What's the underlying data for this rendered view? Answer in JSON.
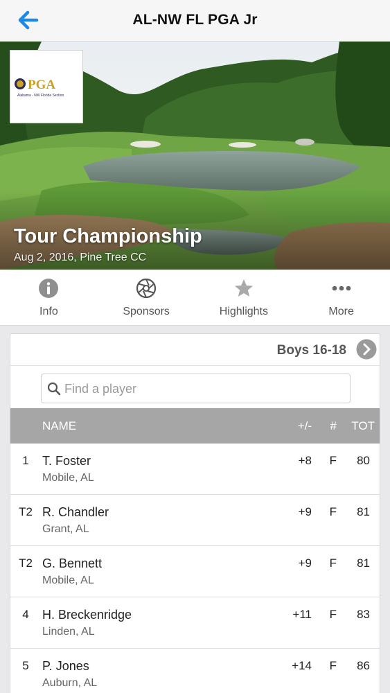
{
  "nav": {
    "title": "AL-NW FL PGA Jr",
    "back_icon": "back-arrow-icon"
  },
  "event": {
    "title": "Tour Championship",
    "subtitle": "Aug 2, 2016, Pine Tree CC",
    "logo": {
      "brand": "PGA",
      "tagline": "Alabama - NW Florida Section"
    }
  },
  "tabs": [
    {
      "label": "Info",
      "icon": "info-icon"
    },
    {
      "label": "Sponsors",
      "icon": "aperture-icon"
    },
    {
      "label": "Highlights",
      "icon": "star-icon"
    },
    {
      "label": "More",
      "icon": "ellipsis-icon"
    }
  ],
  "leaderboard": {
    "division": "Boys 16-18",
    "search_placeholder": "Find a player",
    "columns": {
      "name": "NAME",
      "plus_minus": "+/-",
      "thru": "#",
      "total": "TOT"
    },
    "rows": [
      {
        "pos": "1",
        "name": "T. Foster",
        "city": "Mobile, AL",
        "pm": "+8",
        "thru": "F",
        "tot": "80"
      },
      {
        "pos": "T2",
        "name": "R. Chandler",
        "city": "Grant, AL",
        "pm": "+9",
        "thru": "F",
        "tot": "81"
      },
      {
        "pos": "T2",
        "name": "G. Bennett",
        "city": "Mobile, AL",
        "pm": "+9",
        "thru": "F",
        "tot": "81"
      },
      {
        "pos": "4",
        "name": "H. Breckenridge",
        "city": "Linden, AL",
        "pm": "+11",
        "thru": "F",
        "tot": "83"
      },
      {
        "pos": "5",
        "name": "P. Jones",
        "city": "Auburn, AL",
        "pm": "+14",
        "thru": "F",
        "tot": "86"
      }
    ]
  },
  "colors": {
    "accent": "#1e88e5",
    "header_bg": "#a6a6a6",
    "icon_gray": "#8f8f8f"
  }
}
